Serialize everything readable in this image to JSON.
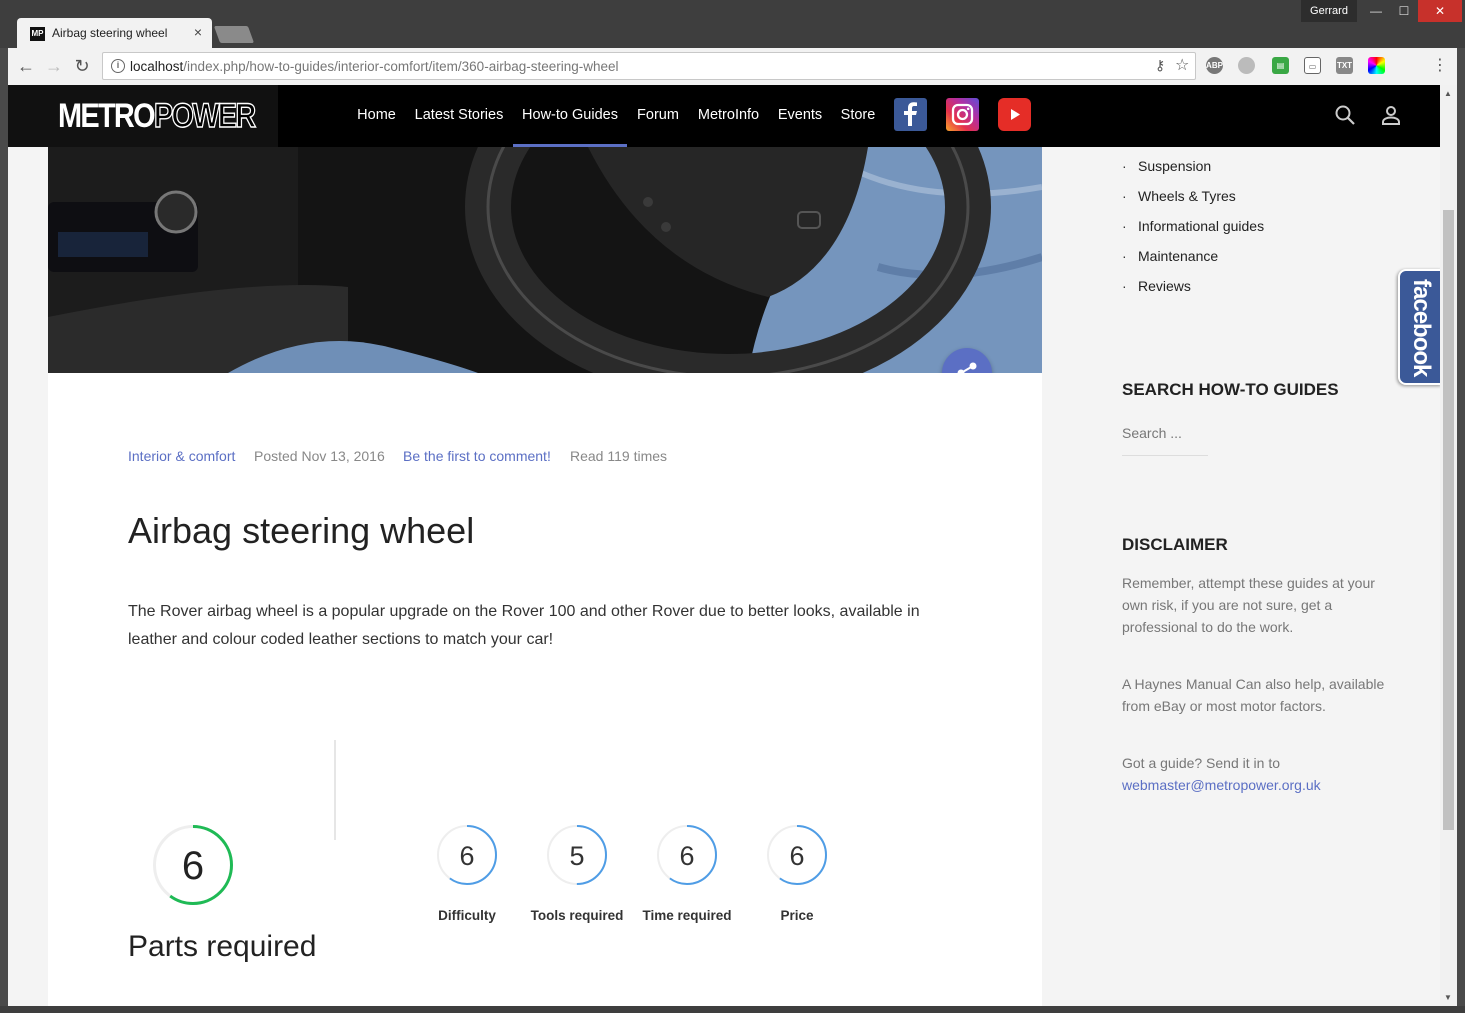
{
  "browser": {
    "tab_title": "Airbag steering wheel",
    "favicon_text": "MP",
    "user": "Gerrard",
    "url_host": "localhost",
    "url_path": "/index.php/how-to-guides/interior-comfort/item/360-airbag-steering-wheel"
  },
  "header": {
    "logo_metro": "METRO",
    "logo_power": "POWER",
    "nav": [
      "Home",
      "Latest Stories",
      "How-to Guides",
      "Forum",
      "MetroInfo",
      "Events",
      "Store"
    ],
    "active_nav": "How-to Guides",
    "accent_color": "#5b6fc4"
  },
  "article": {
    "category": "Interior & comfort",
    "posted": "Posted Nov 13, 2016",
    "comment_link": "Be the first to comment!",
    "reads": "Read 119 times",
    "title": "Airbag steering wheel",
    "intro": "The Rover airbag wheel is a popular upgrade on the Rover 100 and other Rover due to better looks, available in leather and colour coded leather sections to match your car!",
    "overall_rating": "6",
    "overall_color": "#1fba55",
    "ratings": [
      {
        "label": "Difficulty",
        "value": "6"
      },
      {
        "label": "Tools required",
        "value": "5"
      },
      {
        "label": "Time required",
        "value": "6"
      },
      {
        "label": "Price",
        "value": "6"
      }
    ],
    "rating_color": "#4f9de6",
    "parts_heading": "Parts required"
  },
  "sidebar": {
    "categories": [
      "Suspension",
      "Wheels & Tyres",
      "Informational guides",
      "Maintenance",
      "Reviews"
    ],
    "search_heading": "SEARCH HOW-TO GUIDES",
    "search_placeholder": "Search ...",
    "disclaimer_heading": "DISCLAIMER",
    "disclaimer_1": "Remember, attempt these guides at your own risk, if you are not sure, get a professional to do the work.",
    "disclaimer_2": "A Haynes Manual Can also help, available from eBay or most motor factors.",
    "disclaimer_3": "Got a guide? Send it in to",
    "email": "webmaster@metropower.org.uk",
    "facebook_tab": "facebook"
  }
}
